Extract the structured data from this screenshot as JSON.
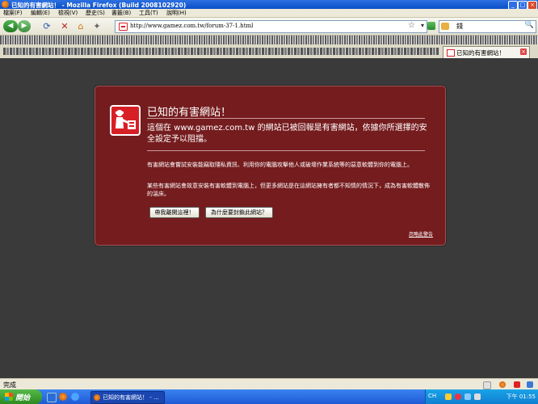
{
  "window": {
    "title": "已知的有害網站！ - Mozilla Firefox (Build 2008102920)",
    "controls": [
      "_",
      "□",
      "×"
    ]
  },
  "menu": [
    "檔案(F)",
    "編輯(E)",
    "檢視(V)",
    "歷史(S)",
    "書籤(B)",
    "工具(T)",
    "說明(H)"
  ],
  "nav": {
    "back_glyph": "◀",
    "forward_glyph": "▶",
    "url": "http://www.gamez.com.tw/forum-37-1.html",
    "search_value": "錢",
    "star_glyph": "☆",
    "dropdown_glyph": "▾",
    "search_glyph": "🔍"
  },
  "tab": {
    "label": "已知的有害網站！",
    "close_glyph": "×"
  },
  "warning": {
    "title": "已知的有害網站！",
    "short_desc": "這個在 www.gamez.com.tw 的網站已被回報是有害網站，依據你所選擇的安全設定予以阻擋。",
    "long_desc_1": "有害網站會嘗試安裝能竊取隱私資訊、利用你的電腦攻擊他人或破壞作業系統等的惡意軟體到你的電腦上。",
    "long_desc_2": "某些有害網站會故意安裝有害軟體到電腦上，但更多網站是在這網站擁有者都不知情的情況下，成為有害軟體散佈的溫床。",
    "get_me_out_button": "帶我離開這裡！",
    "why_blocked_button": "為什麼要封鎖此網站？",
    "ignore_link": "忽略此警告"
  },
  "status": {
    "text": "完成"
  },
  "taskbar": {
    "start_label": "開始",
    "task_item": "已知的有害網站！ - ...",
    "ime": "CH",
    "clock": "下午 01:55"
  },
  "colors": {
    "panel_bg": "#751c1e",
    "page_bg": "#3a3a3a",
    "icon_red": "#d71f26",
    "taskbar_blue": "#1f5ad6"
  }
}
